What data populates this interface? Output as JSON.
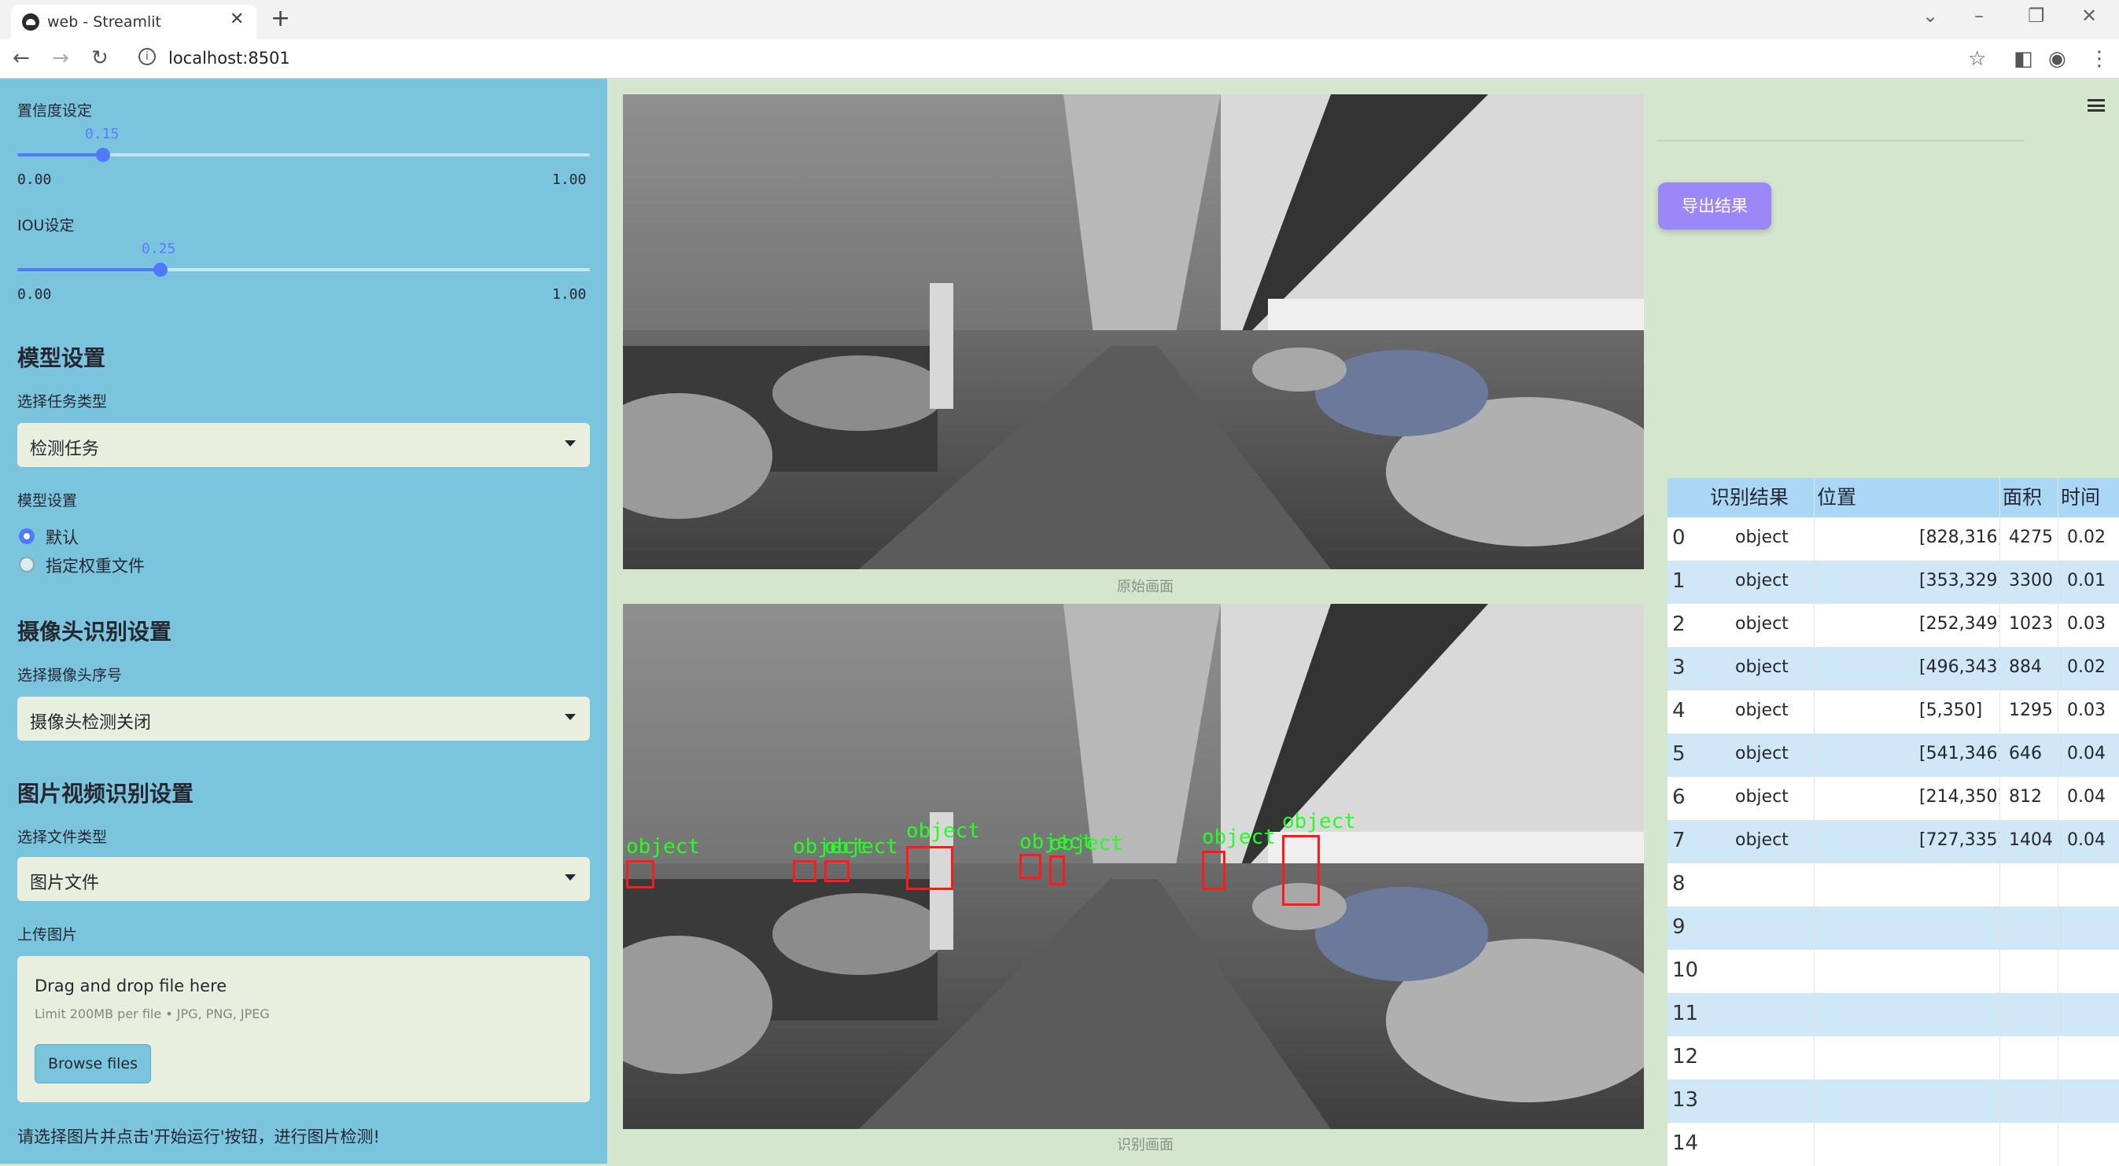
{
  "browser": {
    "tab_title": "web - Streamlit",
    "url": "localhost:8501"
  },
  "sidebar": {
    "confidence_label": "置信度设定",
    "confidence_value": "0.15",
    "confidence_min": "0.00",
    "confidence_max": "1.00",
    "confidence_level": 0.15,
    "iou_label": "IOU设定",
    "iou_value": "0.25",
    "iou_min": "0.00",
    "iou_max": "1.00",
    "iou_level": 0.25,
    "model_section": "模型设置",
    "task_type_label": "选择任务类型",
    "task_type_value": "检测任务",
    "model_setting_label": "模型设置",
    "radio_default": "默认",
    "radio_custom": "指定权重文件",
    "camera_section": "摄像头识别设置",
    "camera_select_label": "选择摄像头序号",
    "camera_select_value": "摄像头检测关闭",
    "media_section": "图片视频识别设置",
    "file_type_label": "选择文件类型",
    "file_type_value": "图片文件",
    "upload_label": "上传图片",
    "upload_drag": "Drag and drop file here",
    "upload_limit": "Limit 200MB per file • JPG, PNG, JPEG",
    "browse_button": "Browse files",
    "hint": "请选择图片并点击'开始运行'按钮，进行图片检测!"
  },
  "main": {
    "original_caption": "原始画面",
    "detected_caption": "识别画面",
    "detection_label": "object"
  },
  "right": {
    "export_button": "导出结果",
    "table_headers": [
      "识别结果",
      "位置",
      "面积",
      "时间"
    ],
    "rows": [
      {
        "idx": "0",
        "result": "object",
        "pos": "[828,316]",
        "area": "4275",
        "time": "0.02"
      },
      {
        "idx": "1",
        "result": "object",
        "pos": "[353,329]",
        "area": "3300",
        "time": "0.01"
      },
      {
        "idx": "2",
        "result": "object",
        "pos": "[252,349]",
        "area": "1023",
        "time": "0.03"
      },
      {
        "idx": "3",
        "result": "object",
        "pos": "[496,343]",
        "area": "884",
        "time": "0.02"
      },
      {
        "idx": "4",
        "result": "object",
        "pos": "[5,350]",
        "area": "1295",
        "time": "0.03"
      },
      {
        "idx": "5",
        "result": "object",
        "pos": "[541,346]",
        "area": "646",
        "time": "0.04"
      },
      {
        "idx": "6",
        "result": "object",
        "pos": "[214,350]",
        "area": "812",
        "time": "0.04"
      },
      {
        "idx": "7",
        "result": "object",
        "pos": "[727,335]",
        "area": "1404",
        "time": "0.04"
      },
      {
        "idx": "8",
        "result": "",
        "pos": "",
        "area": "",
        "time": ""
      },
      {
        "idx": "9",
        "result": "",
        "pos": "",
        "area": "",
        "time": ""
      },
      {
        "idx": "10",
        "result": "",
        "pos": "",
        "area": "",
        "time": ""
      },
      {
        "idx": "11",
        "result": "",
        "pos": "",
        "area": "",
        "time": ""
      },
      {
        "idx": "12",
        "result": "",
        "pos": "",
        "area": "",
        "time": ""
      },
      {
        "idx": "13",
        "result": "",
        "pos": "",
        "area": "",
        "time": ""
      },
      {
        "idx": "14",
        "result": "",
        "pos": "",
        "area": "",
        "time": ""
      }
    ]
  },
  "colors": {
    "sidebar_bg": "#7ac5dd",
    "main_bg": "#d4e6cd",
    "accent": "#4f78ff",
    "export_button": "#9b87f5",
    "detection_box": "#ff1a1a",
    "detection_label": "#22ff22"
  }
}
